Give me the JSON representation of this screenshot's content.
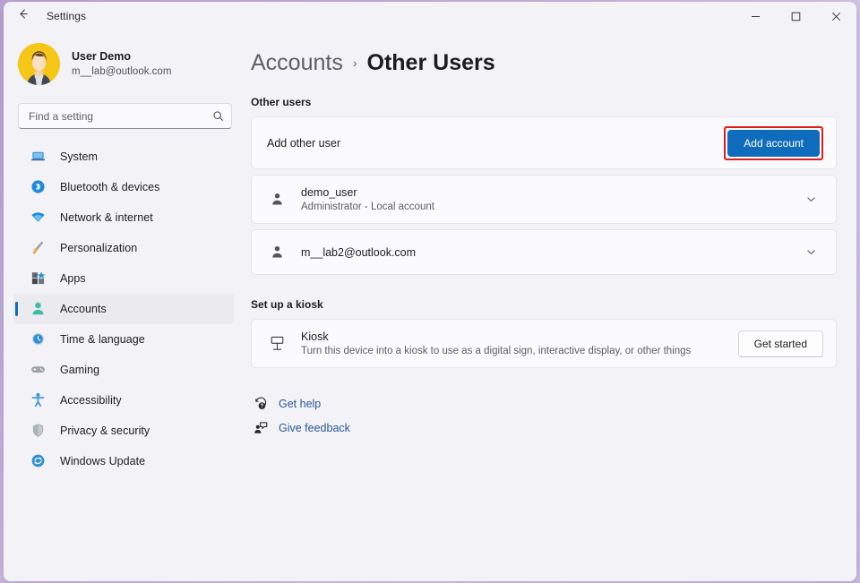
{
  "window": {
    "title": "Settings",
    "back_icon": "arrow-left-icon",
    "controls": {
      "minimize": "–",
      "maximize": "□",
      "close": "✕"
    }
  },
  "sidebar": {
    "profile": {
      "name": "User Demo",
      "email": "m__lab@outlook.com",
      "avatar_bg": "#f5c518"
    },
    "search": {
      "placeholder": "Find a setting",
      "value": "",
      "icon": "search-icon"
    },
    "items": [
      {
        "label": "System",
        "icon": "laptop-icon",
        "selected": false
      },
      {
        "label": "Bluetooth & devices",
        "icon": "bluetooth-icon",
        "selected": false
      },
      {
        "label": "Network & internet",
        "icon": "wifi-icon",
        "selected": false
      },
      {
        "label": "Personalization",
        "icon": "paintbrush-icon",
        "selected": false
      },
      {
        "label": "Apps",
        "icon": "apps-icon",
        "selected": false
      },
      {
        "label": "Accounts",
        "icon": "person-icon",
        "selected": true
      },
      {
        "label": "Time & language",
        "icon": "clock-globe-icon",
        "selected": false
      },
      {
        "label": "Gaming",
        "icon": "gamepad-icon",
        "selected": false
      },
      {
        "label": "Accessibility",
        "icon": "accessibility-icon",
        "selected": false
      },
      {
        "label": "Privacy & security",
        "icon": "shield-icon",
        "selected": false
      },
      {
        "label": "Windows Update",
        "icon": "update-icon",
        "selected": false
      }
    ]
  },
  "main": {
    "breadcrumb": {
      "root": "Accounts",
      "separator": "›",
      "current": "Other Users"
    },
    "other_users": {
      "section_label": "Other users",
      "add_row": {
        "label": "Add other user",
        "button": "Add account",
        "button_color": "#0f6cbd",
        "highlight_color": "#e01b1b"
      },
      "users": [
        {
          "name": "demo_user",
          "detail": "Administrator - Local account",
          "icon": "person-icon",
          "chevron": "chevron-down-icon"
        },
        {
          "name": "m__lab2@outlook.com",
          "detail": "",
          "icon": "person-icon",
          "chevron": "chevron-down-icon"
        }
      ]
    },
    "kiosk": {
      "section_label": "Set up a kiosk",
      "title": "Kiosk",
      "description": "Turn this device into a kiosk to use as a digital sign, interactive display, or other things",
      "icon": "kiosk-icon",
      "button": "Get started"
    },
    "links": [
      {
        "label": "Get help",
        "icon": "help-icon"
      },
      {
        "label": "Give feedback",
        "icon": "feedback-icon"
      }
    ]
  }
}
